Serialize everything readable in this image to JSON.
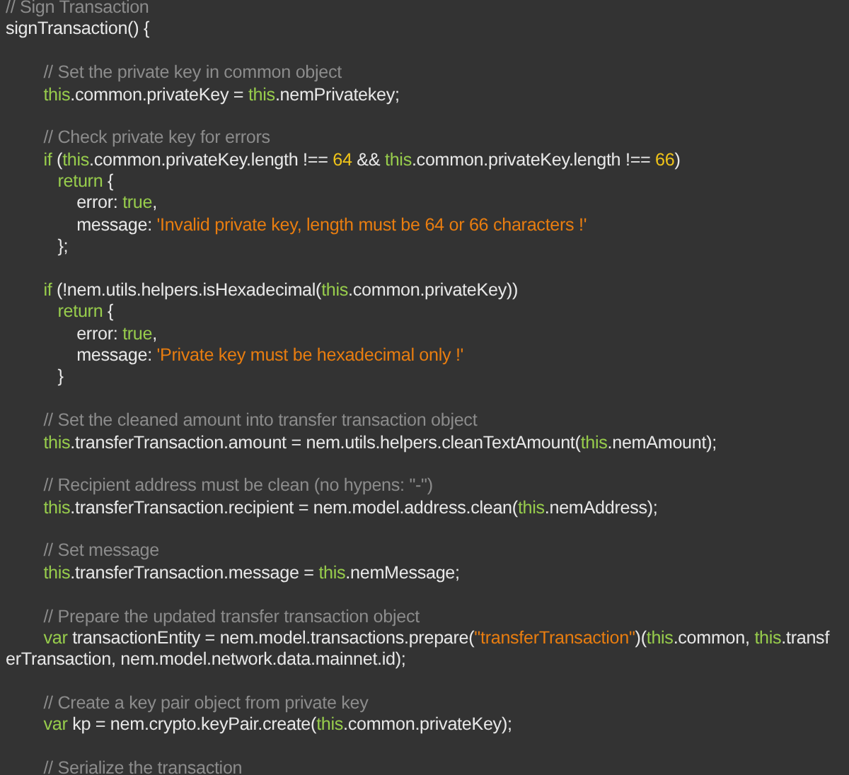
{
  "editor": {
    "lines": [
      {
        "kind": "code",
        "tokens": [
          {
            "kind": "comment",
            "text": "// Sign Transaction"
          }
        ]
      },
      {
        "kind": "code",
        "tokens": [
          {
            "kind": "plain",
            "text": "signTransaction() {"
          }
        ]
      },
      {
        "kind": "blank"
      },
      {
        "kind": "code",
        "tokens": [
          {
            "kind": "comment",
            "text": "        // Set the private key in common object"
          }
        ]
      },
      {
        "kind": "code",
        "tokens": [
          {
            "kind": "keyword",
            "text": "        this"
          },
          {
            "kind": "plain",
            "text": ".common.privateKey = "
          },
          {
            "kind": "keyword",
            "text": "this"
          },
          {
            "kind": "plain",
            "text": ".nemPrivatekey;"
          }
        ]
      },
      {
        "kind": "blank"
      },
      {
        "kind": "code",
        "tokens": [
          {
            "kind": "comment",
            "text": "        // Check private key for errors"
          }
        ]
      },
      {
        "kind": "code",
        "tokens": [
          {
            "kind": "keyword",
            "text": "        if"
          },
          {
            "kind": "plain",
            "text": " ("
          },
          {
            "kind": "keyword",
            "text": "this"
          },
          {
            "kind": "plain",
            "text": ".common.privateKey.length !== "
          },
          {
            "kind": "number",
            "text": "64"
          },
          {
            "kind": "plain",
            "text": " && "
          },
          {
            "kind": "keyword",
            "text": "this"
          },
          {
            "kind": "plain",
            "text": ".common.privateKey.length !== "
          },
          {
            "kind": "number",
            "text": "66"
          },
          {
            "kind": "plain",
            "text": ")"
          }
        ]
      },
      {
        "kind": "code",
        "tokens": [
          {
            "kind": "keyword",
            "text": "           return"
          },
          {
            "kind": "plain",
            "text": " {"
          }
        ]
      },
      {
        "kind": "code",
        "tokens": [
          {
            "kind": "plain",
            "text": "               error: "
          },
          {
            "kind": "keyword",
            "text": "true"
          },
          {
            "kind": "plain",
            "text": ","
          }
        ]
      },
      {
        "kind": "code",
        "tokens": [
          {
            "kind": "plain",
            "text": "               message: "
          },
          {
            "kind": "string",
            "text": "'Invalid private key, length must be 64 or 66 characters !'"
          }
        ]
      },
      {
        "kind": "code",
        "tokens": [
          {
            "kind": "plain",
            "text": "           };"
          }
        ]
      },
      {
        "kind": "blank"
      },
      {
        "kind": "code",
        "tokens": [
          {
            "kind": "keyword",
            "text": "        if"
          },
          {
            "kind": "plain",
            "text": " (!nem.utils.helpers.isHexadecimal("
          },
          {
            "kind": "keyword",
            "text": "this"
          },
          {
            "kind": "plain",
            "text": ".common.privateKey))"
          }
        ]
      },
      {
        "kind": "code",
        "tokens": [
          {
            "kind": "keyword",
            "text": "           return"
          },
          {
            "kind": "plain",
            "text": " {"
          }
        ]
      },
      {
        "kind": "code",
        "tokens": [
          {
            "kind": "plain",
            "text": "               error: "
          },
          {
            "kind": "keyword",
            "text": "true"
          },
          {
            "kind": "plain",
            "text": ","
          }
        ]
      },
      {
        "kind": "code",
        "tokens": [
          {
            "kind": "plain",
            "text": "               message: "
          },
          {
            "kind": "string",
            "text": "'Private key must be hexadecimal only !'"
          }
        ]
      },
      {
        "kind": "code",
        "tokens": [
          {
            "kind": "plain",
            "text": "           }"
          }
        ]
      },
      {
        "kind": "blank"
      },
      {
        "kind": "code",
        "tokens": [
          {
            "kind": "comment",
            "text": "        // Set the cleaned amount into transfer transaction object"
          }
        ]
      },
      {
        "kind": "code",
        "tokens": [
          {
            "kind": "keyword",
            "text": "        this"
          },
          {
            "kind": "plain",
            "text": ".transferTransaction.amount = nem.utils.helpers.cleanTextAmount("
          },
          {
            "kind": "keyword",
            "text": "this"
          },
          {
            "kind": "plain",
            "text": ".nemAmount);"
          }
        ]
      },
      {
        "kind": "blank"
      },
      {
        "kind": "code",
        "tokens": [
          {
            "kind": "comment",
            "text": "        // Recipient address must be clean (no hypens: \"-\")"
          }
        ]
      },
      {
        "kind": "code",
        "tokens": [
          {
            "kind": "keyword",
            "text": "        this"
          },
          {
            "kind": "plain",
            "text": ".transferTransaction.recipient = nem.model.address.clean("
          },
          {
            "kind": "keyword",
            "text": "this"
          },
          {
            "kind": "plain",
            "text": ".nemAddress);"
          }
        ]
      },
      {
        "kind": "blank"
      },
      {
        "kind": "code",
        "tokens": [
          {
            "kind": "comment",
            "text": "        // Set message"
          }
        ]
      },
      {
        "kind": "code",
        "tokens": [
          {
            "kind": "keyword",
            "text": "        this"
          },
          {
            "kind": "plain",
            "text": ".transferTransaction.message = "
          },
          {
            "kind": "keyword",
            "text": "this"
          },
          {
            "kind": "plain",
            "text": ".nemMessage;"
          }
        ]
      },
      {
        "kind": "blank"
      },
      {
        "kind": "code",
        "tokens": [
          {
            "kind": "comment",
            "text": "        // Prepare the updated transfer transaction object"
          }
        ]
      },
      {
        "kind": "code",
        "tokens": [
          {
            "kind": "keyword",
            "text": "        var"
          },
          {
            "kind": "plain",
            "text": " transactionEntity = nem.model.transactions.prepare("
          },
          {
            "kind": "string",
            "text": "\"transferTransaction\""
          },
          {
            "kind": "plain",
            "text": ")("
          },
          {
            "kind": "keyword",
            "text": "this"
          },
          {
            "kind": "plain",
            "text": ".common, "
          },
          {
            "kind": "keyword",
            "text": "this"
          },
          {
            "kind": "plain",
            "text": ".transf"
          }
        ]
      },
      {
        "kind": "code",
        "tokens": [
          {
            "kind": "plain",
            "text": "erTransaction, nem.model.network.data.mainnet.id);"
          }
        ]
      },
      {
        "kind": "blank"
      },
      {
        "kind": "code",
        "tokens": [
          {
            "kind": "comment",
            "text": "        // Create a key pair object from private key"
          }
        ]
      },
      {
        "kind": "code",
        "tokens": [
          {
            "kind": "keyword",
            "text": "        var"
          },
          {
            "kind": "plain",
            "text": " kp = nem.crypto.keyPair.create("
          },
          {
            "kind": "keyword",
            "text": "this"
          },
          {
            "kind": "plain",
            "text": ".common.privateKey);"
          }
        ]
      },
      {
        "kind": "blank"
      },
      {
        "kind": "code",
        "tokens": [
          {
            "kind": "comment",
            "text": "        // Serialize the transaction"
          }
        ]
      }
    ]
  }
}
